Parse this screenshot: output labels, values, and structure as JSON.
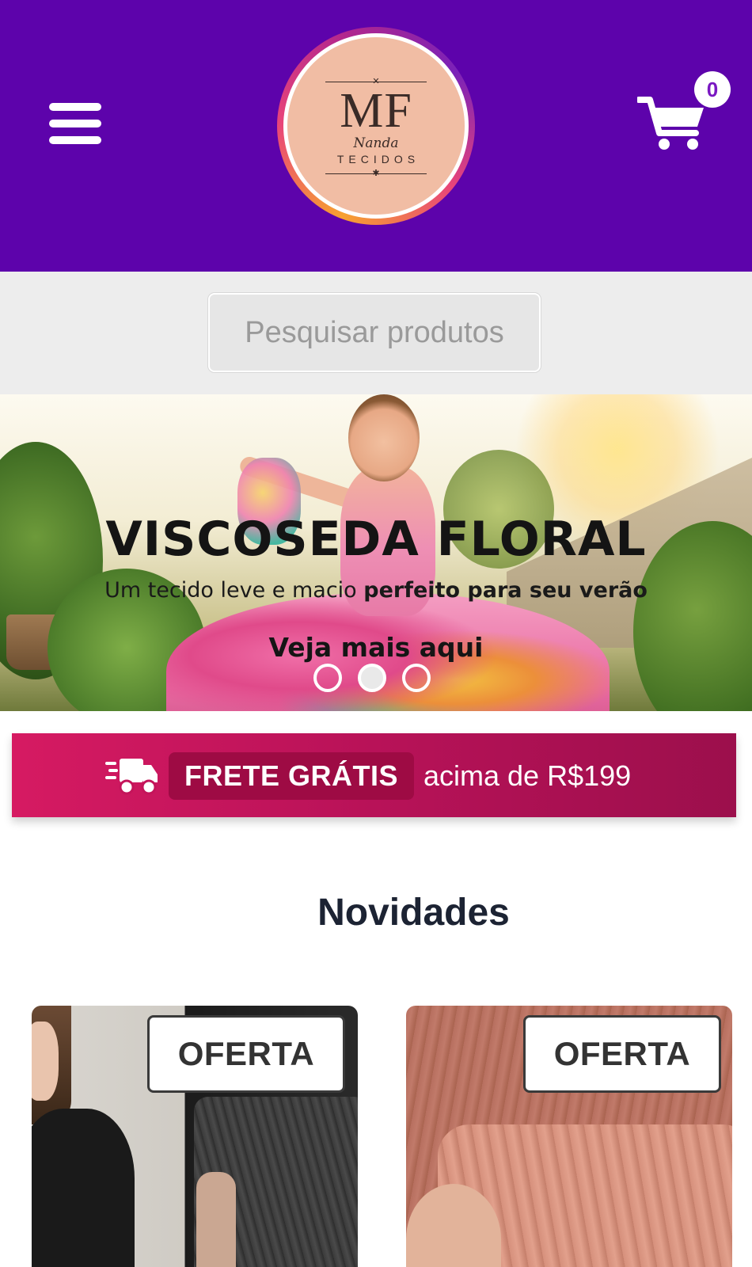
{
  "header": {
    "menu_icon": "hamburger-menu-icon",
    "logo": {
      "initials": "MF",
      "script_name": "Nanda",
      "subtitle": "TECIDOS"
    },
    "cart": {
      "icon": "shopping-cart-icon",
      "count": "0"
    },
    "colors": {
      "background": "#5d03ab",
      "cart_badge_text": "#7a18c2"
    }
  },
  "search": {
    "placeholder": "Pesquisar produtos"
  },
  "banner": {
    "title": "VISCOSEDA FLORAL",
    "subtitle_regular": "Um tecido leve e macio ",
    "subtitle_bold": "perfeito para seu verão",
    "cta": "Veja mais aqui",
    "slides": {
      "count": 3,
      "active": 2
    }
  },
  "shipping": {
    "icon": "delivery-truck-icon",
    "highlight": "FRETE GRÁTIS",
    "text": "acima de R$199",
    "colors": {
      "from": "#d61a62",
      "to": "#9c0f4c"
    }
  },
  "section": {
    "title": "Novidades"
  },
  "products": [
    {
      "badge": "OFERTA"
    },
    {
      "badge": "OFERTA"
    }
  ]
}
